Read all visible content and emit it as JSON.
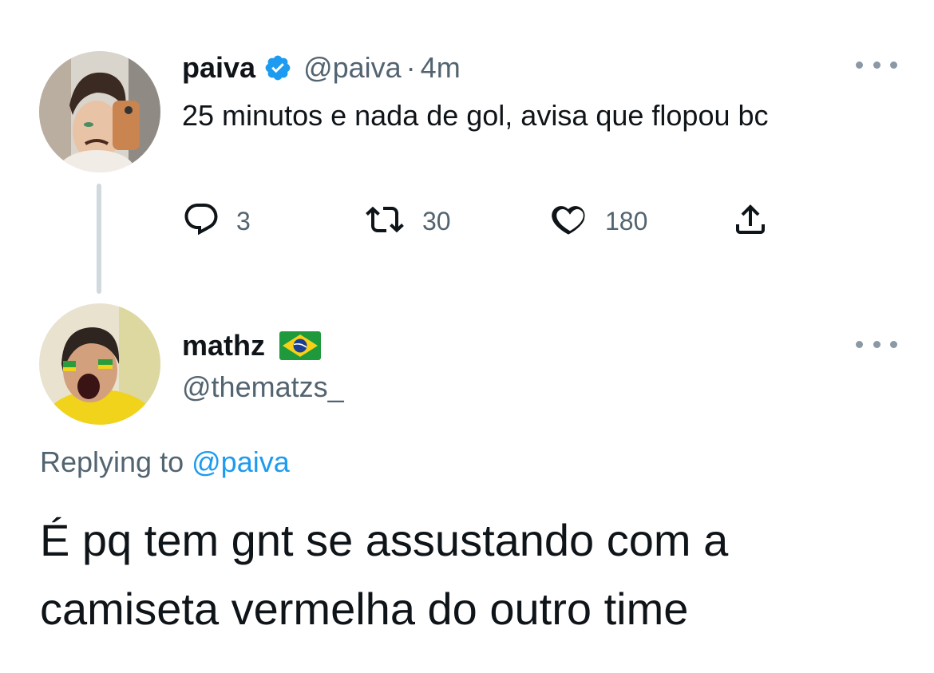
{
  "parent_tweet": {
    "author_name": "paiva",
    "verified": true,
    "handle": "@paiva",
    "separator": "·",
    "time": "4m",
    "text": "25 minutos e nada de gol, avisa que flopou bc",
    "actions": {
      "reply_count": "3",
      "retweet_count": "30",
      "like_count": "180"
    },
    "icons": [
      "verified-badge-icon",
      "more-icon",
      "reply-icon",
      "retweet-icon",
      "like-icon",
      "share-icon"
    ]
  },
  "reply_tweet": {
    "author_name": "mathz",
    "name_emoji": "brazil-flag",
    "handle": "@thematzs_",
    "replying_prefix": "Replying to",
    "replying_to": "@paiva",
    "text": "É pq tem gnt se assustando com a camiseta vermelha do outro time"
  },
  "colors": {
    "text_primary": "#0f1419",
    "text_secondary": "#536471",
    "accent_blue": "#1d9bf0",
    "thread_line": "#cfd9de"
  }
}
